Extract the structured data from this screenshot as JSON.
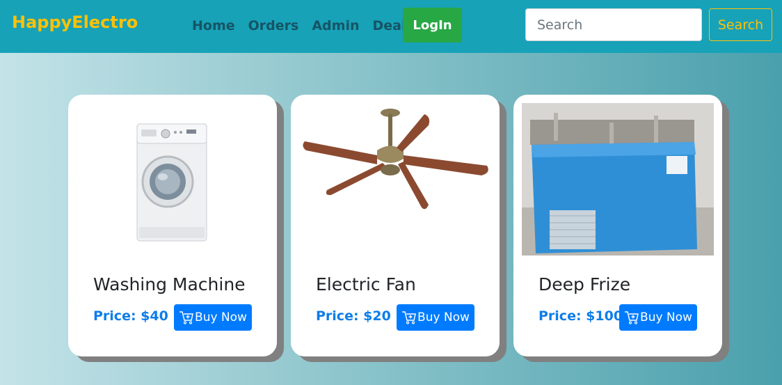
{
  "brand": "HappyElectro",
  "nav": {
    "links": [
      "Home",
      "Orders",
      "Admin",
      "Deals"
    ],
    "login_label": "LogIn"
  },
  "search": {
    "placeholder": "Search",
    "button_label": "Search"
  },
  "colors": {
    "navbar": "#17a2b8",
    "brand": "#ffc107",
    "login": "#28a745",
    "buy": "#007bff",
    "price": "#0d7dea"
  },
  "products": [
    {
      "name": "Washing Machine",
      "price": "Price: $40",
      "buy_label": "Buy Now",
      "image": "washing-machine-image"
    },
    {
      "name": "Electric Fan",
      "price": "Price: $20",
      "buy_label": "Buy Now",
      "image": "ceiling-fan-image"
    },
    {
      "name": "Deep Frize",
      "price": "Price: $100",
      "buy_label": "Buy Now",
      "image": "deep-freezer-image"
    }
  ],
  "icons": {
    "cart": "cart-plus-icon"
  }
}
